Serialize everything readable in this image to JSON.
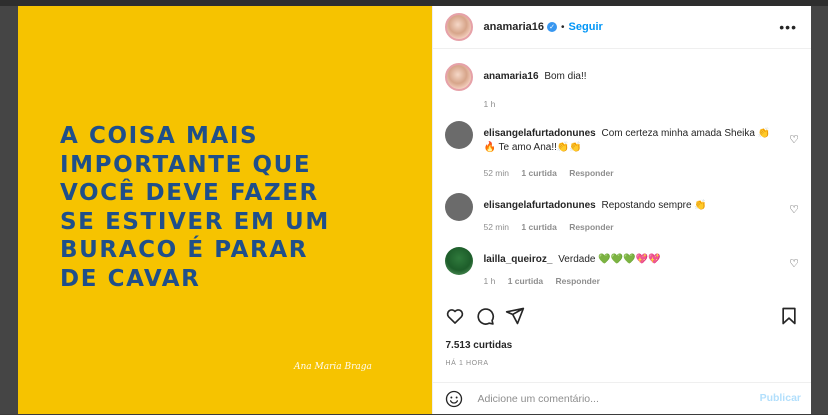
{
  "post": {
    "quote": "A COISA MAIS\nIMPORTANTE QUE\nVOCÊ DEVE FAZER\nSE ESTIVER EM UM\nBURACO É PARAR\nDE CAVAR",
    "signature": "Ana Maria Braga",
    "colors": {
      "background": "#f6c300",
      "quote": "#1f4f8a"
    }
  },
  "header": {
    "username": "anamaria16",
    "separator": "•",
    "follow_label": "Seguir",
    "more": "•••"
  },
  "caption": {
    "username": "anamaria16",
    "text": "Bom dia!!",
    "time": "1 h"
  },
  "comments": [
    {
      "username": "elisangelafurtadonunes",
      "text": "Com certeza minha amada Sheika 👏 🔥 Te amo Ana!!👏👏",
      "time": "52 min",
      "likes": "1 curtida",
      "reply": "Responder"
    },
    {
      "username": "elisangelafurtadonunes",
      "text": "Repostando sempre 👏",
      "time": "52 min",
      "likes": "1 curtida",
      "reply": "Responder"
    },
    {
      "username": "lailla_queiroz_",
      "text": "Verdade 💚💚💚💖💖",
      "time": "1 h",
      "likes": "1 curtida",
      "reply": "Responder"
    }
  ],
  "actions": {
    "icons": [
      "heart-icon",
      "comment-icon",
      "share-icon",
      "bookmark-icon"
    ]
  },
  "likes_count": "7.513 curtidas",
  "posted_ago": "HÁ 1 HORA",
  "add_comment": {
    "placeholder": "Adicione um comentário...",
    "publish_label": "Publicar"
  }
}
